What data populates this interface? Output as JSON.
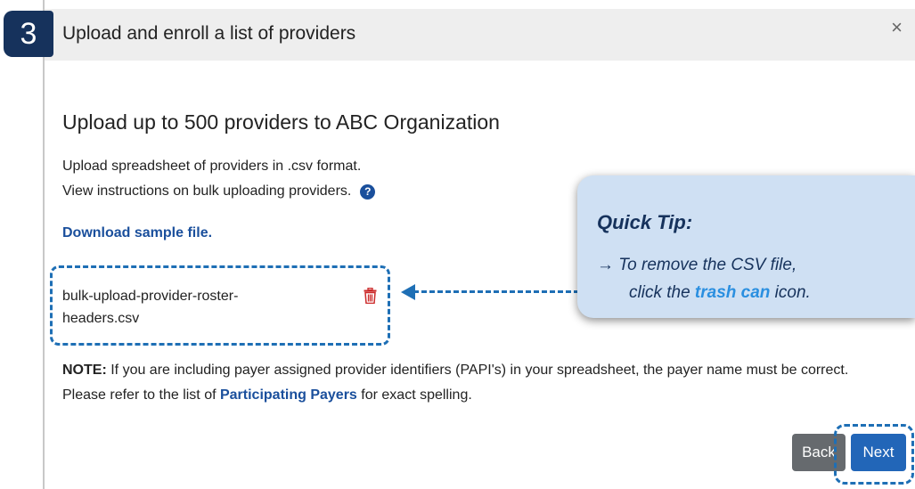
{
  "step": {
    "number": "3"
  },
  "dialog": {
    "title": "Upload and enroll a list of providers",
    "close_label": "×"
  },
  "content": {
    "heading": "Upload up to 500 providers to ABC Organization",
    "line1": "Upload spreadsheet of providers in .csv format.",
    "line2": "View instructions on bulk uploading providers.",
    "help_icon": "question-circle-icon",
    "download_link": "Download sample file.",
    "file": {
      "name_part1": "bulk-upload-provider-roster-",
      "name_part2": "headers.csv",
      "icon": "trash-icon",
      "icon_color": "#cc2a2a"
    },
    "note": {
      "label": "NOTE:",
      "text1": " If you are including payer assigned provider identifiers (PAPI's) in your spreadsheet, the payer name must be correct. Please refer to the list of ",
      "link": "Participating Payers",
      "text2": " for exact spelling."
    }
  },
  "buttons": {
    "back": "Back",
    "next": "Next"
  },
  "tip": {
    "title": "Quick Tip:",
    "arrow": "→",
    "line1": "To remove the CSV file,",
    "line2_pre": "click the ",
    "line2_hl": "trash can",
    "line2_post": " icon."
  },
  "colors": {
    "primary": "#2266b8",
    "link": "#1a4f9c",
    "header_bg": "#eeeeee",
    "tip_bg": "#cfe0f3",
    "badge_bg": "#16325c",
    "dashed_outline": "#1e6fb5"
  }
}
